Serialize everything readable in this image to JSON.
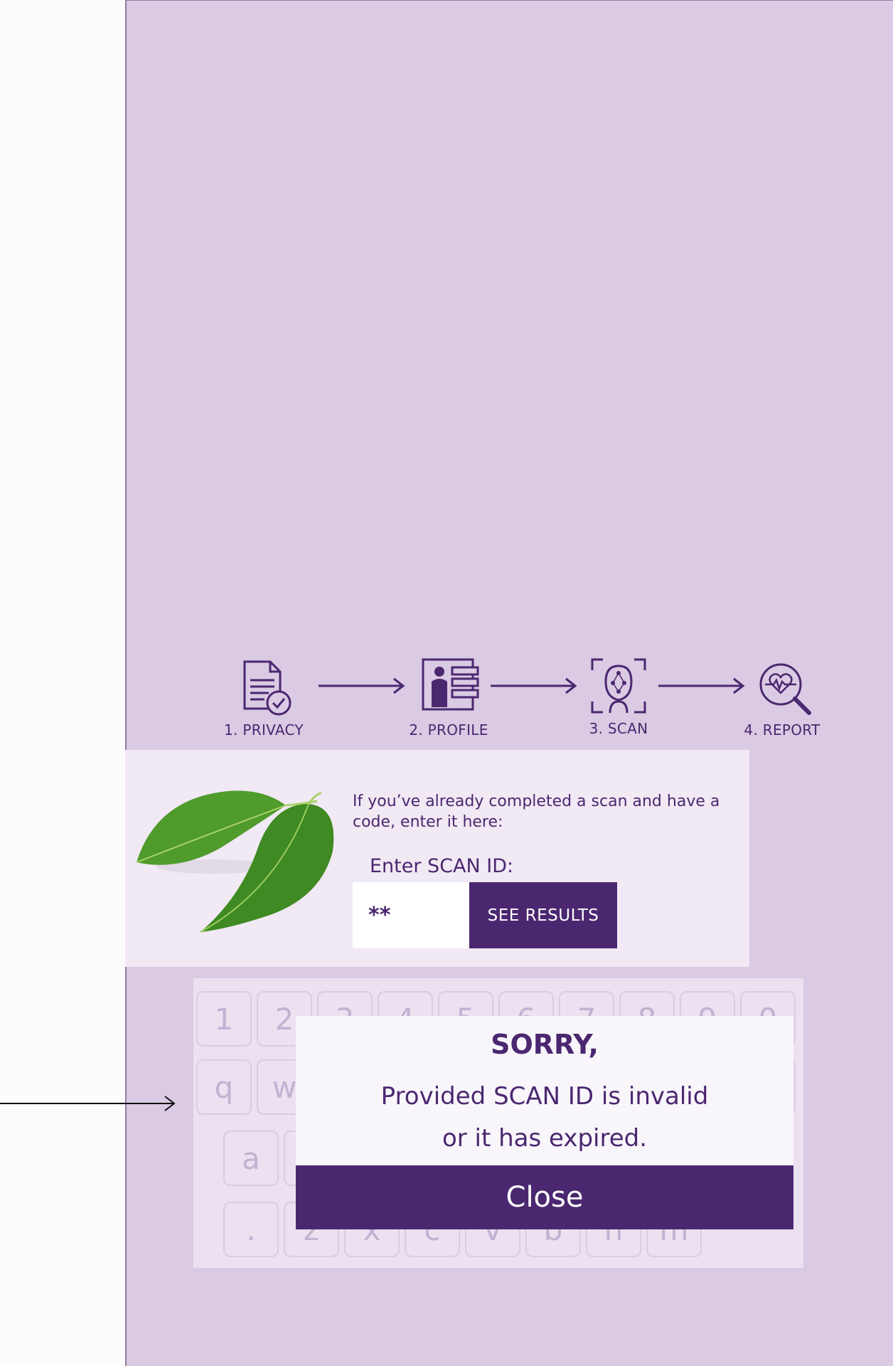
{
  "steps": [
    {
      "label": "1. PRIVACY",
      "icon": "privacy-document-icon"
    },
    {
      "label": "2. PROFILE",
      "icon": "profile-icon"
    },
    {
      "label": "3. SCAN",
      "icon": "face-scan-icon"
    },
    {
      "label": "4. REPORT",
      "icon": "report-magnifier-icon"
    }
  ],
  "scan": {
    "intro": "If you’ve already completed a scan and have a code, enter it here:",
    "label": "Enter SCAN ID:",
    "input_value": "**",
    "button": "SEE RESULTS"
  },
  "keyboard": {
    "row1": [
      "1",
      "2",
      "3",
      "4",
      "5",
      "6",
      "7",
      "8",
      "9",
      "0"
    ],
    "row2": [
      "q",
      "w"
    ],
    "row3": [
      "a"
    ],
    "row4": [
      ".",
      "z",
      "x",
      "c",
      "v",
      "b",
      "n",
      "m"
    ]
  },
  "modal": {
    "title": "SORRY,",
    "line1": "Provided SCAN ID is invalid",
    "line2": "or it has expired.",
    "close": "Close"
  },
  "colors": {
    "accent": "#4b2770",
    "panel": "#dacae3",
    "card": "#f1e9f4"
  }
}
